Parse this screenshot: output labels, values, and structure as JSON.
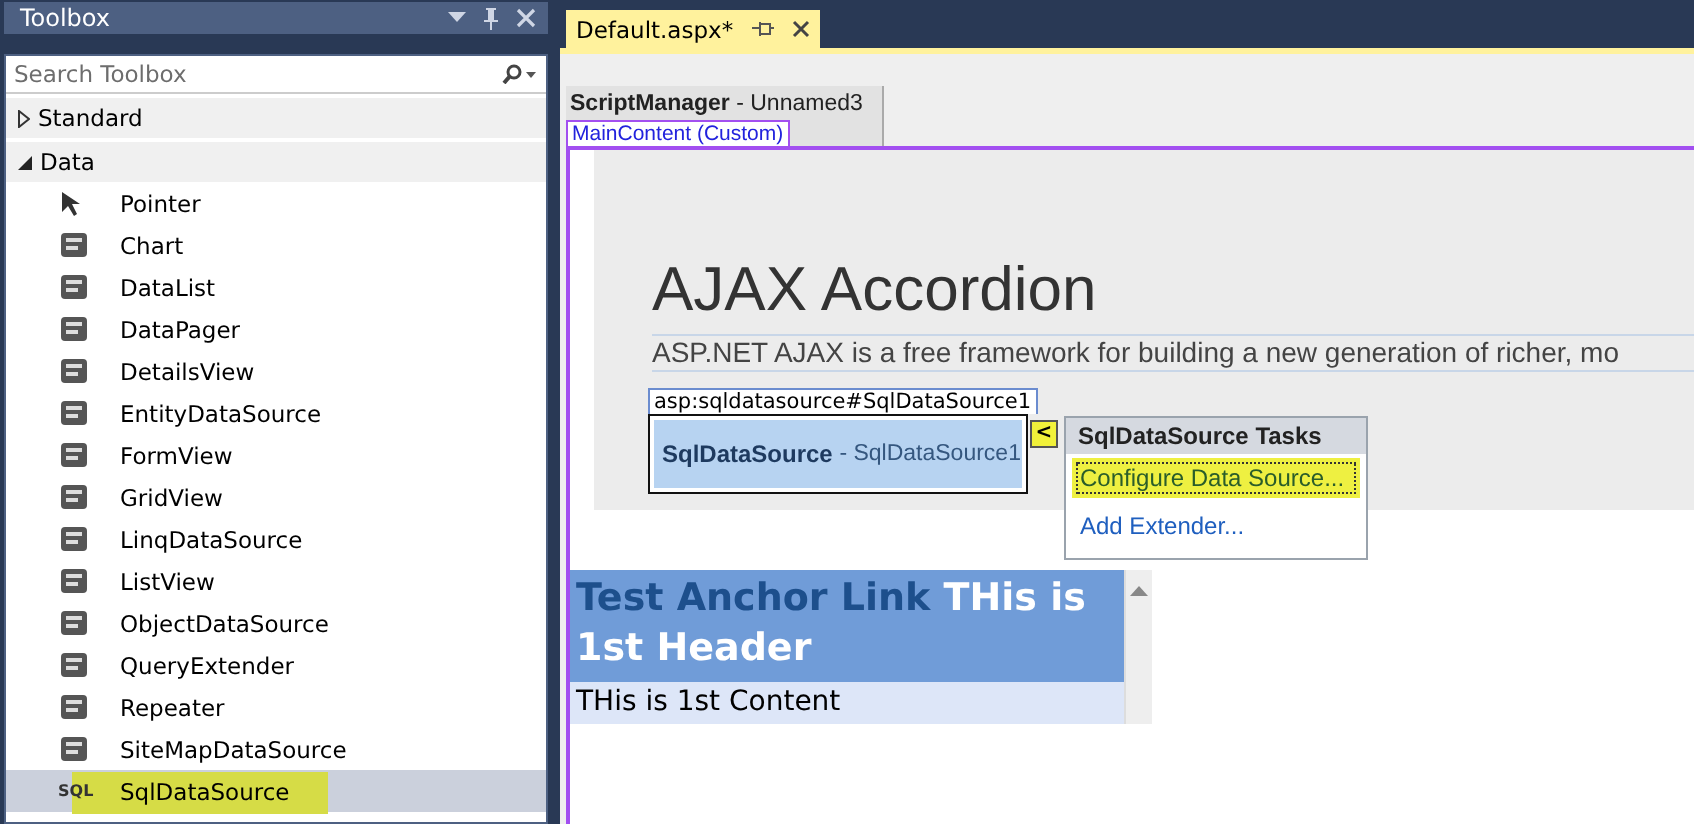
{
  "toolbox": {
    "title": "Toolbox",
    "search": {
      "placeholder": "Search Toolbox"
    },
    "categories": [
      {
        "label": "Standard",
        "expanded": false
      },
      {
        "label": "Data",
        "expanded": true,
        "items": [
          {
            "label": "Pointer",
            "selected": false,
            "highlighted": false
          },
          {
            "label": "Chart",
            "selected": false,
            "highlighted": false
          },
          {
            "label": "DataList",
            "selected": false,
            "highlighted": false
          },
          {
            "label": "DataPager",
            "selected": false,
            "highlighted": false
          },
          {
            "label": "DetailsView",
            "selected": false,
            "highlighted": false
          },
          {
            "label": "EntityDataSource",
            "selected": false,
            "highlighted": false
          },
          {
            "label": "FormView",
            "selected": false,
            "highlighted": false
          },
          {
            "label": "GridView",
            "selected": false,
            "highlighted": false
          },
          {
            "label": "LinqDataSource",
            "selected": false,
            "highlighted": false
          },
          {
            "label": "ListView",
            "selected": false,
            "highlighted": false
          },
          {
            "label": "ObjectDataSource",
            "selected": false,
            "highlighted": false
          },
          {
            "label": "QueryExtender",
            "selected": false,
            "highlighted": false
          },
          {
            "label": "Repeater",
            "selected": false,
            "highlighted": false
          },
          {
            "label": "SiteMapDataSource",
            "selected": false,
            "highlighted": false
          },
          {
            "label": "SqlDataSource",
            "icon_text": "SQL",
            "selected": true,
            "highlighted": true
          }
        ]
      }
    ]
  },
  "tabs": [
    {
      "label": "Default.aspx*",
      "selected": true
    }
  ],
  "designer": {
    "script_manager": {
      "type": "ScriptManager",
      "name": "- Unnamed3"
    },
    "content_label": "MainContent (Custom)",
    "heading": "AJAX Accordion",
    "description": "ASP.NET AJAX is a free framework for building a new generation of richer, mo",
    "control": {
      "tag": "asp:sqldatasource#SqlDataSource1",
      "type": "SqlDataSource",
      "name": "- SqlDataSource1"
    },
    "smart_tag": {
      "arrow": "<",
      "title": "SqlDataSource Tasks",
      "items": [
        {
          "label": "Configure Data Source...",
          "highlighted": true
        },
        {
          "label": "Add Extender...",
          "highlighted": false
        }
      ]
    },
    "accordion": {
      "link": "Test Anchor Link",
      "header": "THis is 1st Header",
      "content": "THis is 1st Content"
    }
  }
}
